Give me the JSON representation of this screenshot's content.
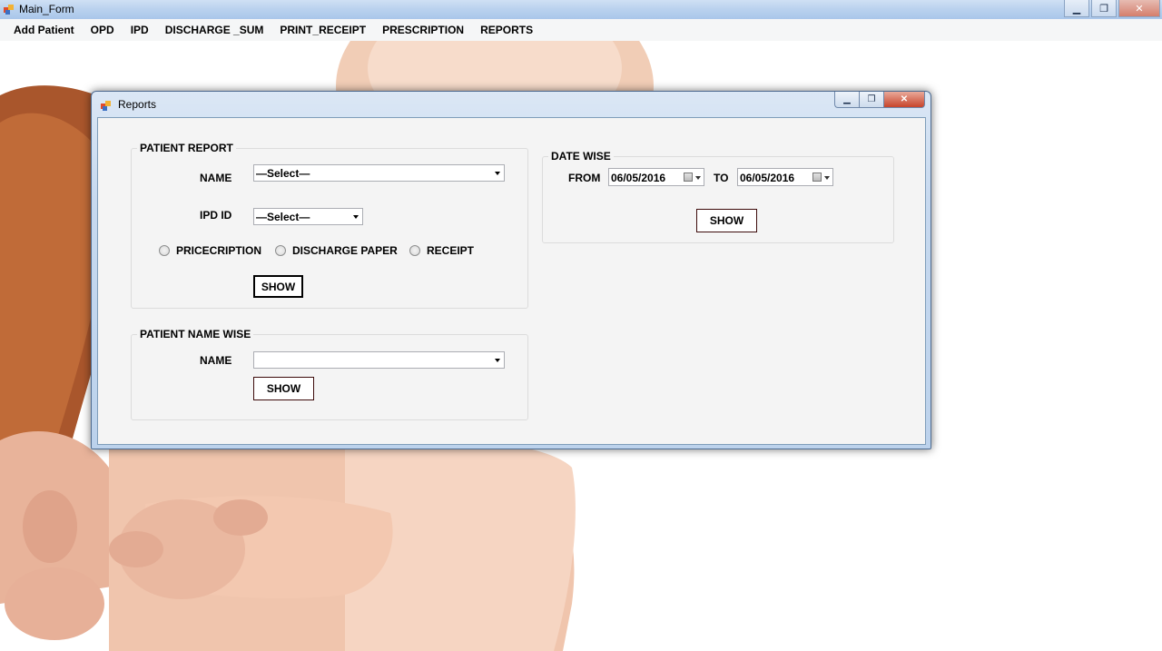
{
  "main_window": {
    "title": "Main_Form",
    "controls": {
      "minimize": "▁",
      "restore": "❐",
      "close": "✕"
    }
  },
  "menu": {
    "items": [
      "Add Patient",
      "OPD",
      "IPD",
      "DISCHARGE _SUM",
      "PRINT_RECEIPT",
      "PRESCRIPTION",
      "REPORTS"
    ]
  },
  "reports_window": {
    "title": "Reports",
    "controls": {
      "minimize": "▁",
      "restore": "❐",
      "close": "✕"
    },
    "patient_report": {
      "legend": "PATIENT REPORT",
      "name_label": "NAME",
      "name_value": "—Select—",
      "ipd_label": "IPD ID",
      "ipd_value": "—Select—",
      "radios": [
        "PRICECRIPTION",
        "DISCHARGE PAPER",
        "RECEIPT"
      ],
      "show_label": "SHOW"
    },
    "patient_name_wise": {
      "legend": "PATIENT NAME WISE",
      "name_label": "NAME",
      "name_value": "",
      "show_label": "SHOW"
    },
    "date_wise": {
      "legend": "DATE WISE",
      "from_label": "FROM",
      "from_value": "06/05/2016",
      "to_label": "TO",
      "to_value": "06/05/2016",
      "show_label": "SHOW"
    }
  },
  "colors": {
    "titlebar": "#b9d1ee",
    "client_bg": "#f4f4f4",
    "close_button": "#c7442a"
  }
}
